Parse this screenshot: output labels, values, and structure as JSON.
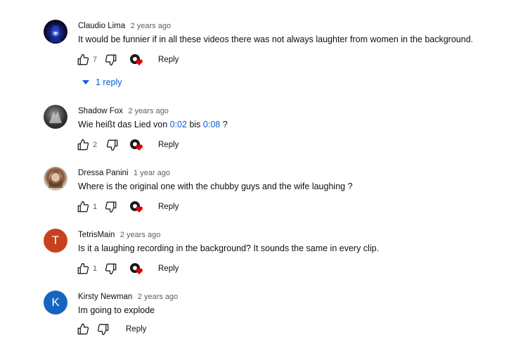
{
  "comments": [
    {
      "author": "Claudio Lima",
      "time": "2 years ago",
      "text": "It would be funnier if in all these videos there was not always laughter from women in the background.",
      "likes": "7",
      "reply_label": "Reply",
      "avatar_icon": "profile-photo"
    },
    {
      "author": "Shadow Fox",
      "time": "2 years ago",
      "text_prefix": "Wie heißt das Lied von ",
      "ts1": "0:02",
      "text_mid": " bis ",
      "ts2": "0:08",
      "text_suffix": " ?",
      "likes": "2",
      "reply_label": "Reply",
      "avatar_icon": "profile-photo"
    },
    {
      "author": "Dressa Panini",
      "time": "1 year ago",
      "text": "Where is the original one with the chubby guys and the wife laughing ?",
      "likes": "1",
      "reply_label": "Reply",
      "avatar_icon": "profile-photo"
    },
    {
      "author": "TetrisMain",
      "time": "2 years ago",
      "text": "Is it a laughing recording in the background?  It sounds the same in every clip.",
      "likes": "1",
      "reply_label": "Reply",
      "avatar_letter": "T",
      "avatar_color": "#c9401f"
    },
    {
      "author": "Kirsty Newman",
      "time": "2 years ago",
      "text": "Im going to explode",
      "reply_label": "Reply",
      "avatar_letter": "K",
      "avatar_color": "#1565c0"
    }
  ],
  "replies_toggle": {
    "label": "1 reply",
    "icon": "triangle-down-icon"
  },
  "colors": {
    "link": "#065fd4",
    "heart": "#e00000",
    "muted": "#606060"
  }
}
